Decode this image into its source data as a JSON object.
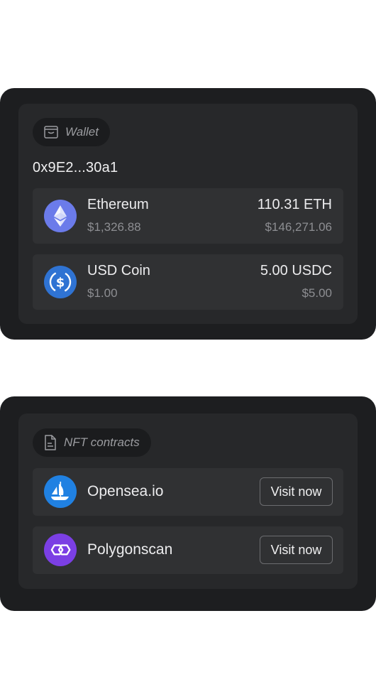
{
  "wallet_card": {
    "chip_label": "Wallet",
    "chip_icon": "wallet-icon",
    "address": "0x9E2...30a1",
    "tokens": [
      {
        "name": "Ethereum",
        "price": "$1,326.88",
        "amount": "110.31 ETH",
        "value": "$146,271.06",
        "icon": "ethereum-icon",
        "icon_color": "#6b7bea"
      },
      {
        "name": "USD Coin",
        "price": "$1.00",
        "amount": "5.00 USDC",
        "value": "$5.00",
        "icon": "usdc-icon",
        "icon_color": "#2f73d3"
      }
    ]
  },
  "nft_card": {
    "chip_label": "NFT contracts",
    "chip_icon": "document-icon",
    "items": [
      {
        "name": "Opensea.io",
        "button": "Visit now",
        "icon": "opensea-icon",
        "icon_color": "#2081e2"
      },
      {
        "name": "Polygonscan",
        "button": "Visit now",
        "icon": "polygon-icon",
        "icon_color": "#7b3fe4"
      }
    ]
  }
}
